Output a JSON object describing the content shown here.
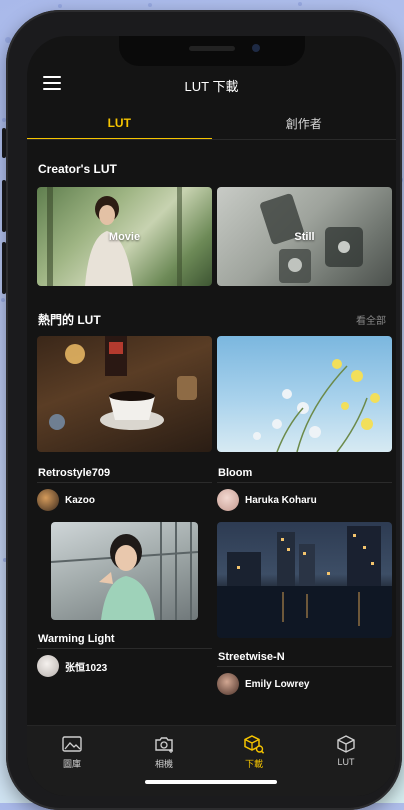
{
  "header": {
    "title": "LUT 下載"
  },
  "tabs": [
    {
      "label": "LUT",
      "active": true
    },
    {
      "label": "創作者",
      "active": false
    }
  ],
  "creators_section": {
    "title": "Creator's LUT",
    "tiles": [
      {
        "label": "Movie"
      },
      {
        "label": "Still"
      }
    ]
  },
  "popular_section": {
    "title": "熱門的 LUT",
    "see_all": "看全部",
    "cards": [
      {
        "name": "Retrostyle709",
        "author": "Kazoo"
      },
      {
        "name": "Bloom",
        "author": "Haruka Koharu"
      },
      {
        "name": "Warming Light",
        "author": "张恒1023"
      },
      {
        "name": "Streetwise-N",
        "author": "Emily Lowrey"
      }
    ]
  },
  "bottom_nav": [
    {
      "label": "圖庫",
      "icon": "gallery-icon",
      "active": false
    },
    {
      "label": "相機",
      "icon": "camera-icon",
      "active": false
    },
    {
      "label": "下載",
      "icon": "download-cube-icon",
      "active": true
    },
    {
      "label": "LUT",
      "icon": "cube-icon",
      "active": false
    }
  ],
  "colors": {
    "accent": "#f5c400",
    "background": "#141414"
  }
}
